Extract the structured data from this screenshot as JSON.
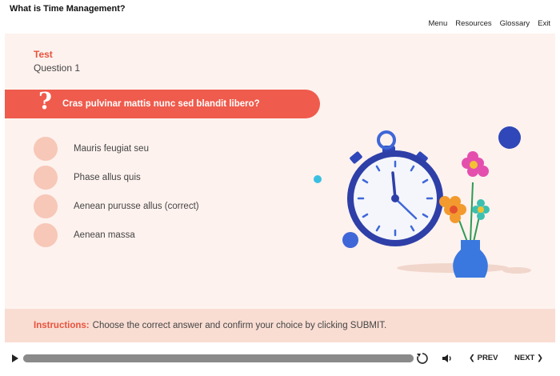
{
  "app": {
    "title": "What is Time Management?"
  },
  "nav": {
    "menu": "Menu",
    "resources": "Resources",
    "glossary": "Glossary",
    "exit": "Exit"
  },
  "slide": {
    "section": "Test",
    "question_number": "Question 1",
    "question_mark": "?",
    "question": "Cras pulvinar mattis nunc sed blandit libero?",
    "options": [
      {
        "label": "Mauris feugiat seu"
      },
      {
        "label": "Phase allus quis"
      },
      {
        "label": "Aenean purusse allus (correct)"
      },
      {
        "label": "Aenean massa"
      }
    ],
    "illustration": {
      "icons": [
        "stopwatch-icon",
        "flower-vase-icon"
      ]
    }
  },
  "instructions": {
    "label": "Instructions:",
    "text": "Choose the correct answer and confirm your choice by clicking SUBMIT."
  },
  "player": {
    "prev_label": "PREV",
    "next_label": "NEXT",
    "progress": 1.0,
    "icons": [
      "play-icon",
      "replay-icon",
      "volume-icon",
      "chevron-left-icon",
      "chevron-right-icon"
    ]
  },
  "colors": {
    "accent": "#ef5b4c",
    "accent_text": "#e8533e",
    "slide_bg": "#fdf2ee",
    "radio": "#f7c7b7",
    "instructions_bg": "#f9ddd3"
  }
}
